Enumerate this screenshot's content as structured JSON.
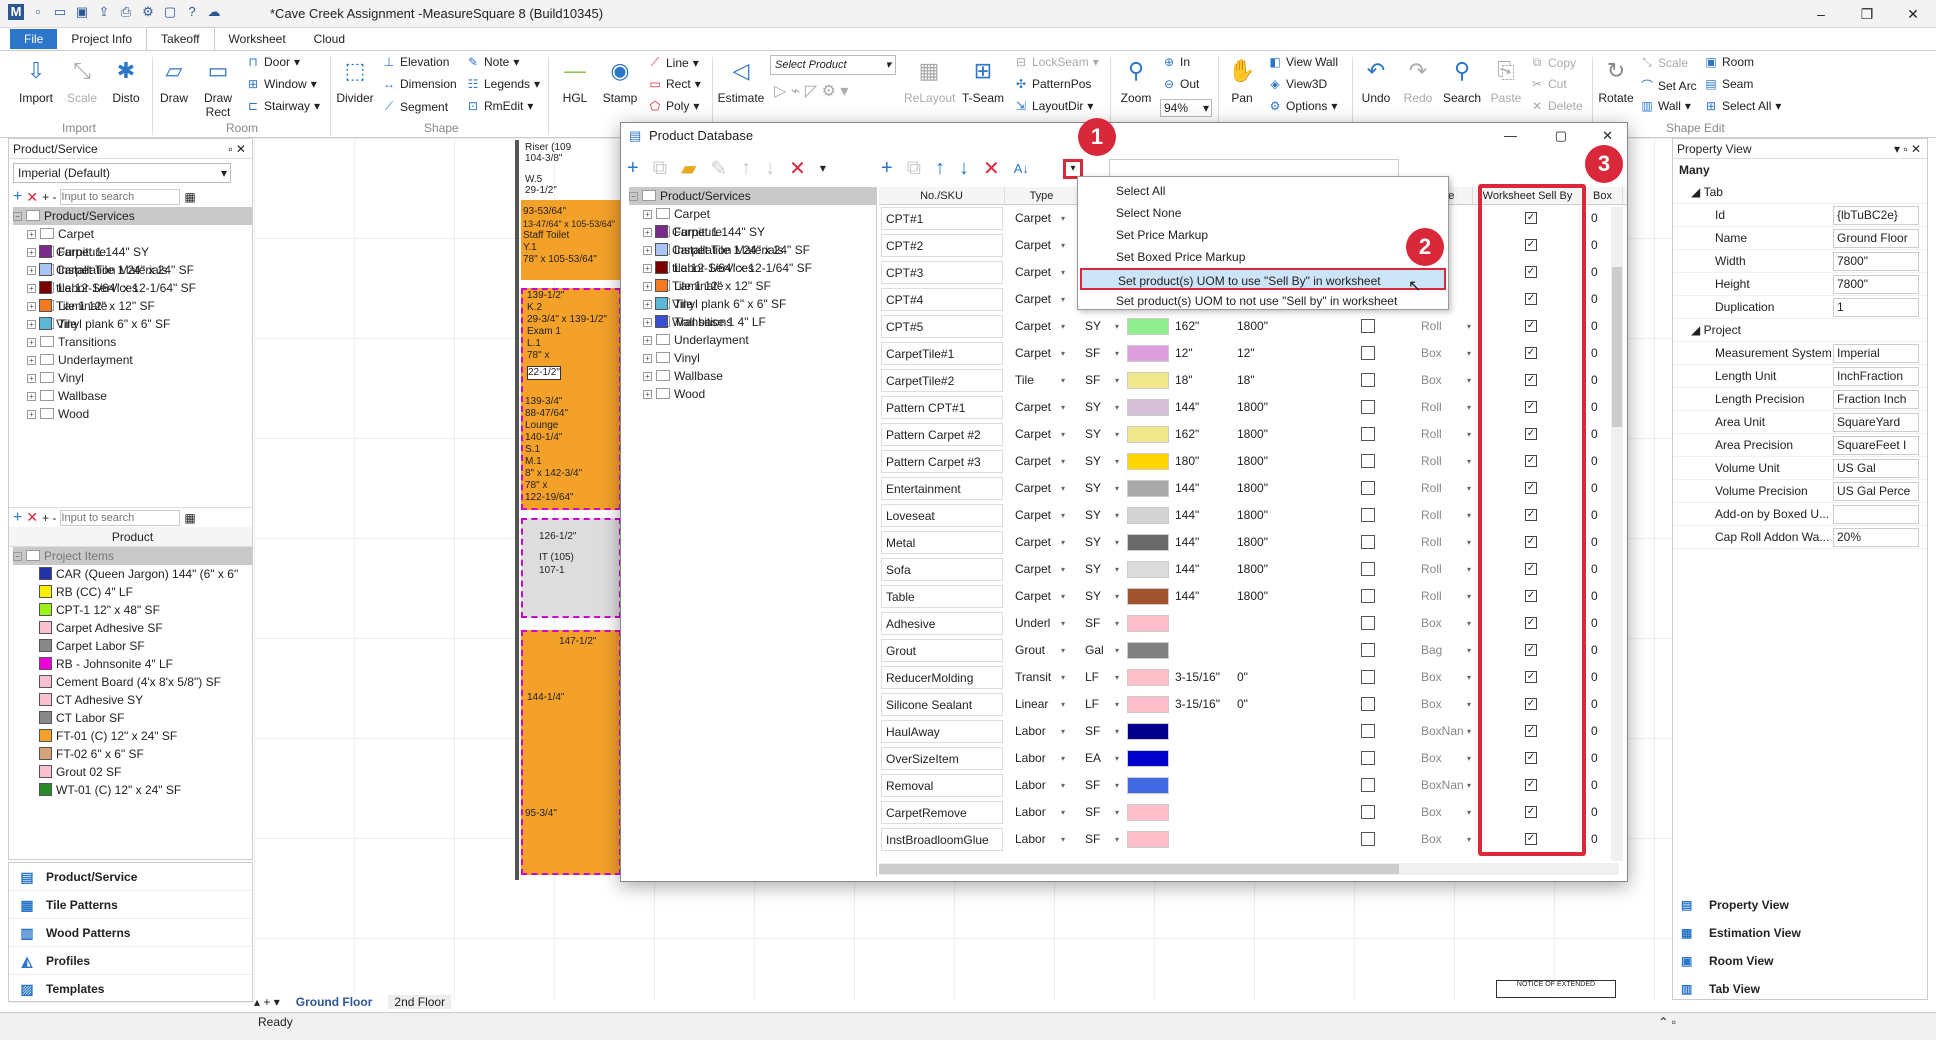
{
  "app": {
    "title": "*Cave Creek Assignment -MeasureSquare 8 (Build10345)"
  },
  "menu": {
    "file": "File",
    "tabs": [
      "Project Info",
      "Takeoff",
      "Worksheet",
      "Cloud"
    ]
  },
  "ribbon": {
    "import": "Import",
    "scale": "Scale",
    "disto": "Disto",
    "draw": "Draw",
    "draw_rect": "Draw Rect",
    "door": "Door",
    "window": "Window",
    "stairway": "Stairway",
    "divider": "Divider",
    "elevation": "Elevation",
    "dimension": "Dimension",
    "segment": "Segment",
    "note": "Note",
    "legends": "Legends",
    "rmedit": "RmEdit",
    "hgl": "HGL",
    "stamp": "Stamp",
    "line": "Line",
    "rect": "Rect",
    "poly": "Poly",
    "estimate": "Estimate",
    "select_product": "Select Product",
    "relayout": "ReLayout",
    "tseam": "T-Seam",
    "lockseam": "LockSeam",
    "patternpos": "PatternPos",
    "layoutdir": "LayoutDir",
    "zoom": "Zoom",
    "in": "In",
    "out": "Out",
    "zoom_level": "94%",
    "pan": "Pan",
    "viewwall": "View Wall",
    "view3d": "View3D",
    "options": "Options",
    "undo": "Undo",
    "redo": "Redo",
    "search": "Search",
    "paste": "Paste",
    "copy": "Copy",
    "cut": "Cut",
    "delete": "Delete",
    "rotate": "Rotate",
    "scale2": "Scale",
    "setarc": "Set Arc",
    "wall": "Wall",
    "room": "Room",
    "seam": "Seam",
    "select_all": "Select All",
    "groups": {
      "import": "Import",
      "room": "Room",
      "shape": "Shape",
      "shape_edit": "Shape Edit"
    }
  },
  "left_panel": {
    "header": "Product/Service",
    "preset": "Imperial (Default)",
    "search_placeholder": "Input to search",
    "tree_root": "Product/Services",
    "categories": [
      "Carpet",
      "Furniture",
      "Installation Materials",
      "Labor Services",
      "Laminate",
      "Tile",
      "Transitions",
      "Underlayment",
      "Vinyl",
      "Wallbase",
      "Wood"
    ],
    "products": [
      {
        "label": "Carpet 1 144\" SY",
        "color": "#7a2a8a"
      },
      {
        "label": "Carpet Tile 1 24\" x 24\" SF",
        "color": "#aac4f4"
      },
      {
        "label": "tile 12-1/64\" x 12-1/64\" SF",
        "color": "#7a0000"
      },
      {
        "label": "Tile 1 12\" x 12\" SF",
        "color": "#f47a20"
      },
      {
        "label": "Vinyl plank 6\" x 6\" SF",
        "color": "#5ab7d6"
      }
    ],
    "search2_placeholder": "Input to search",
    "product_header": "Product",
    "project_items_label": "Project Items",
    "project_items": [
      {
        "label": "CAR (Queen Jargon) 144\" (6\" x 6\"",
        "color": "#2233aa"
      },
      {
        "label": "RB (CC) 4\" LF",
        "color": "#f7f100"
      },
      {
        "label": "CPT-1 12\" x 48\" SF",
        "color": "#9ef01a"
      },
      {
        "label": "Carpet Adhesive  SF",
        "color": "#f9c1d0"
      },
      {
        "label": "Carpet Labor  SF",
        "color": "#888888"
      },
      {
        "label": "RB - Johnsonite 4\" LF",
        "color": "#f000d8"
      },
      {
        "label": "Cement Board (4'x 8'x 5/8\")  SF",
        "color": "#f9c1d0"
      },
      {
        "label": "CT Adhesive  SY",
        "color": "#f9c1d0"
      },
      {
        "label": "CT Labor  SF",
        "color": "#888888"
      },
      {
        "label": "FT-01 (C) 12\" x 24\" SF",
        "color": "#f4a12a"
      },
      {
        "label": "FT-02 6\" x 6\" SF",
        "color": "#d2a478"
      },
      {
        "label": "Grout 02  SF",
        "color": "#f9c1d0"
      },
      {
        "label": "WT-01 (C) 12\" x 24\" SF",
        "color": "#2a8a2a"
      }
    ]
  },
  "nav": [
    "Product/Service",
    "Tile Patterns",
    "Wood Patterns",
    "Profiles",
    "Templates"
  ],
  "floor_tabs": [
    "Ground Floor",
    "2nd Floor"
  ],
  "status": "Ready",
  "dialog": {
    "title": "Product Database",
    "tree_root": "Product/Services",
    "categories": [
      "Carpet",
      "Furniture",
      "Installation Materials",
      "Labor Services",
      "Laminate",
      "Tile",
      "Transitions",
      "Underlayment",
      "Vinyl",
      "Wallbase",
      "Wood"
    ],
    "products": [
      {
        "label": "Carpet 1 144\" SY",
        "color": "#7a2a8a"
      },
      {
        "label": "Carpet Tile 1 24\" x 24\" SF",
        "color": "#aac4f4"
      },
      {
        "label": "tile 12-1/64\" x 12-1/64\" SF",
        "color": "#7a0000"
      },
      {
        "label": "Tile 1 12\" x 12\" SF",
        "color": "#f47a20"
      },
      {
        "label": "Vinyl plank 6\" x 6\" SF",
        "color": "#5ab7d6"
      },
      {
        "label": "Wall base 1 4\" LF",
        "color": "#3a4fd0"
      }
    ],
    "columns": [
      "No./SKU",
      "Type",
      "",
      "",
      "",
      "",
      "",
      "y Me",
      "Worksheet Sell By",
      "Box"
    ],
    "rows": [
      {
        "sku": "CPT#1",
        "type": "Carpet",
        "uom": "",
        "color": "",
        "w": "",
        "l": "",
        "boxed": false,
        "sell": "",
        "ws": true
      },
      {
        "sku": "CPT#2",
        "type": "Carpet",
        "uom": "",
        "color": "",
        "w": "",
        "l": "",
        "boxed": false,
        "sell": "",
        "ws": true
      },
      {
        "sku": "CPT#3",
        "type": "Carpet",
        "uom": "",
        "color": "",
        "w": "",
        "l": "",
        "boxed": false,
        "sell": "",
        "ws": true
      },
      {
        "sku": "CPT#4",
        "type": "Carpet",
        "uom": "",
        "color": "",
        "w": "",
        "l": "",
        "boxed": false,
        "sell": "",
        "ws": true
      },
      {
        "sku": "CPT#5",
        "type": "Carpet",
        "uom": "SY",
        "color": "#90ee90",
        "w": "162\"",
        "l": "1800\"",
        "boxed": false,
        "sell": "Roll",
        "ws": true
      },
      {
        "sku": "CarpetTile#1",
        "type": "Carpet",
        "uom": "SF",
        "color": "#dda0dd",
        "w": "12\"",
        "l": "12\"",
        "boxed": false,
        "sell": "Box",
        "ws": true
      },
      {
        "sku": "CarpetTile#2",
        "type": "Tile",
        "uom": "SF",
        "color": "#f0e68c",
        "w": "18\"",
        "l": "18\"",
        "boxed": false,
        "sell": "Box",
        "ws": true
      },
      {
        "sku": "Pattern CPT#1",
        "type": "Carpet",
        "uom": "SY",
        "color": "#d8bfd8",
        "w": "144\"",
        "l": "1800\"",
        "boxed": false,
        "sell": "Roll",
        "ws": true
      },
      {
        "sku": "Pattern Carpet #2",
        "type": "Carpet",
        "uom": "SY",
        "color": "#f0e68c",
        "w": "162\"",
        "l": "1800\"",
        "boxed": false,
        "sell": "Roll",
        "ws": true
      },
      {
        "sku": "Pattern Carpet #3",
        "type": "Carpet",
        "uom": "SY",
        "color": "#ffd700",
        "w": "180\"",
        "l": "1800\"",
        "boxed": false,
        "sell": "Roll",
        "ws": true
      },
      {
        "sku": "Entertainment",
        "type": "Carpet",
        "uom": "SY",
        "color": "#a9a9a9",
        "w": "144\"",
        "l": "1800\"",
        "boxed": false,
        "sell": "Roll",
        "ws": true
      },
      {
        "sku": "Loveseat",
        "type": "Carpet",
        "uom": "SY",
        "color": "#d3d3d3",
        "w": "144\"",
        "l": "1800\"",
        "boxed": false,
        "sell": "Roll",
        "ws": true
      },
      {
        "sku": "Metal",
        "type": "Carpet",
        "uom": "SY",
        "color": "#696969",
        "w": "144\"",
        "l": "1800\"",
        "boxed": false,
        "sell": "Roll",
        "ws": true
      },
      {
        "sku": "Sofa",
        "type": "Carpet",
        "uom": "SY",
        "color": "#dcdcdc",
        "w": "144\"",
        "l": "1800\"",
        "boxed": false,
        "sell": "Roll",
        "ws": true
      },
      {
        "sku": "Table",
        "type": "Carpet",
        "uom": "SY",
        "color": "#a0522d",
        "w": "144\"",
        "l": "1800\"",
        "boxed": false,
        "sell": "Roll",
        "ws": true
      },
      {
        "sku": "Adhesive",
        "type": "Underl",
        "uom": "SF",
        "color": "#ffc0cb",
        "w": "",
        "l": "",
        "boxed": false,
        "sell": "Box",
        "ws": true
      },
      {
        "sku": "Grout",
        "type": "Grout",
        "uom": "Gal",
        "color": "#808080",
        "w": "",
        "l": "",
        "boxed": false,
        "sell": "Bag",
        "ws": true
      },
      {
        "sku": "ReducerMolding",
        "type": "Transit",
        "uom": "LF",
        "color": "#ffc0cb",
        "w": "3-15/16\"",
        "l": "0\"",
        "boxed": false,
        "sell": "Box",
        "ws": true
      },
      {
        "sku": "Silicone Sealant",
        "type": "Linear",
        "uom": "LF",
        "color": "#ffc0cb",
        "w": "3-15/16\"",
        "l": "0\"",
        "boxed": false,
        "sell": "Box",
        "ws": true
      },
      {
        "sku": "HaulAway",
        "type": "Labor",
        "uom": "SF",
        "color": "#00008b",
        "w": "",
        "l": "",
        "boxed": false,
        "sell": "BoxNan",
        "ws": true
      },
      {
        "sku": "OverSizeItem",
        "type": "Labor",
        "uom": "EA",
        "color": "#0000cd",
        "w": "",
        "l": "",
        "boxed": false,
        "sell": "Box",
        "ws": true
      },
      {
        "sku": "Removal",
        "type": "Labor",
        "uom": "SF",
        "color": "#4169e1",
        "w": "",
        "l": "",
        "boxed": false,
        "sell": "BoxNan",
        "ws": true
      },
      {
        "sku": "CarpetRemove",
        "type": "Labor",
        "uom": "SF",
        "color": "#ffc0cb",
        "w": "",
        "l": "",
        "boxed": false,
        "sell": "Box",
        "ws": true
      },
      {
        "sku": "InstBroadloomGlue",
        "type": "Labor",
        "uom": "SF",
        "color": "#ffc0cb",
        "w": "",
        "l": "",
        "boxed": false,
        "sell": "Box",
        "ws": true
      }
    ]
  },
  "context_menu": [
    "Select All",
    "Select None",
    "Set Price Markup",
    "Set Boxed Price Markup",
    "Set product(s) UOM to use \"Sell By\" in worksheet",
    "Set product(s) UOM to not use \"Sell by\" in worksheet"
  ],
  "badges": [
    "1",
    "2",
    "3"
  ],
  "right_panel": {
    "header": "Property View",
    "selection": "Many",
    "tab_group": "Tab",
    "props": [
      {
        "k": "Id",
        "v": "{lbTuBC2e}"
      },
      {
        "k": "Name",
        "v": "Ground Floor"
      },
      {
        "k": "Width",
        "v": "7800\""
      },
      {
        "k": "Height",
        "v": "7800\""
      },
      {
        "k": "Duplication",
        "v": "1"
      }
    ],
    "project_group": "Project",
    "project_props": [
      {
        "k": "Measurement System",
        "v": "Imperial"
      },
      {
        "k": "Length Unit",
        "v": "InchFraction"
      },
      {
        "k": "Length Precision",
        "v": "Fraction Inch"
      },
      {
        "k": "Area Unit",
        "v": "SquareYard"
      },
      {
        "k": "Area Precision",
        "v": "SquareFeet I"
      },
      {
        "k": "Volume Unit",
        "v": "US Gal"
      },
      {
        "k": "Volume Precision",
        "v": "US Gal Perce"
      },
      {
        "k": "Add-on by Boxed U...",
        "v": ""
      },
      {
        "k": "Cap Roll Addon Wa...",
        "v": "20%"
      }
    ],
    "views": [
      "Property View",
      "Estimation View",
      "Room View",
      "Tab View"
    ]
  },
  "plan_labels": [
    "Riser (109",
    "104-3/8\"",
    "W.5",
    "29-1/2\"",
    "J.4",
    "93-53/64\"",
    "13-47/64\" x 105-53/64\"",
    "Staff Toilet",
    "Y.1",
    "78\" x 105-53/64\"",
    "K.2",
    "139-1/2\"",
    "29-3/4\" x 139-1/2\"",
    "Exam 1",
    "L.1",
    "78\" x",
    "22-1/2\"",
    "139-3/4\"",
    "88-47/64\"",
    "Lounge",
    "140-1/4\"",
    "S.1",
    "M.1",
    "8\" x 142-3/4\"",
    "78\" x",
    "122-19/64\"",
    "126-1/2\"",
    "IT (105)",
    "107-1",
    "147-1/2\"",
    "144-1/4\"",
    "95-3/4\"",
    "NOTICE OF EXTENDED"
  ]
}
